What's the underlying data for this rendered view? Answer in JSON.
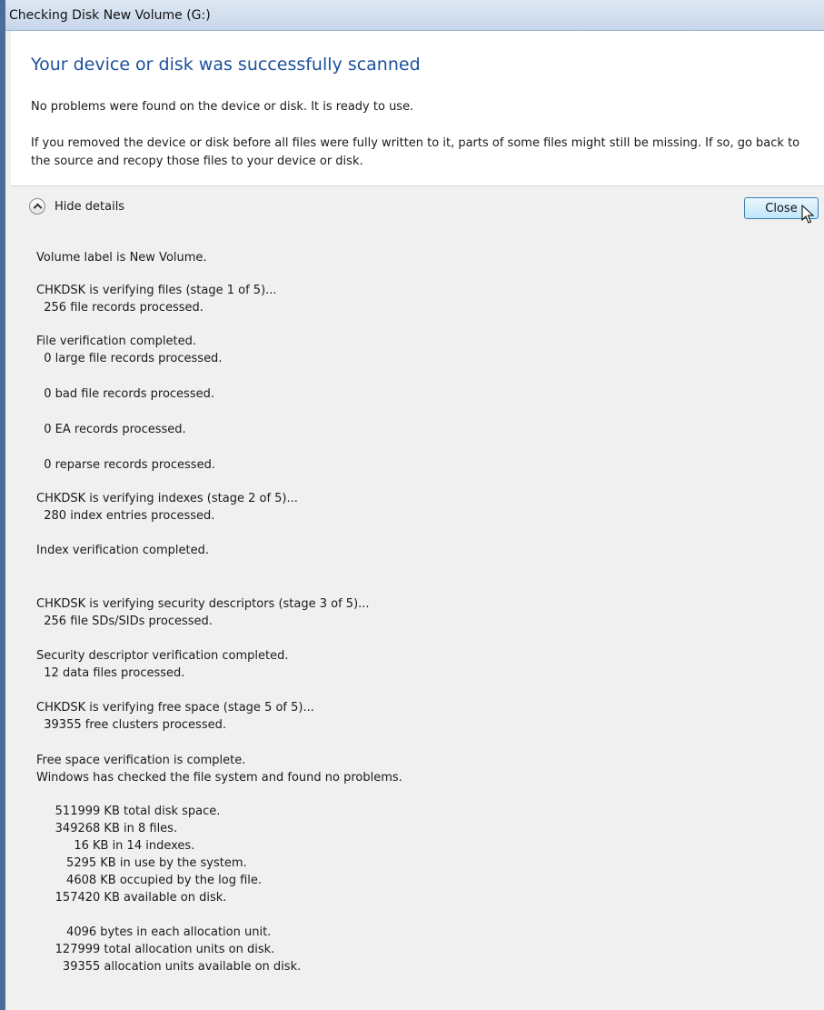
{
  "window": {
    "title": "Checking Disk New Volume (G:)"
  },
  "header": {
    "heading": "Your device or disk was successfully scanned",
    "message1": "No problems were found on the device or disk. It is ready to use.",
    "message2": "If you removed the device or disk before all files were fully written to it, parts of some files might still be missing. If so, go back to the source and recopy those files to your device or disk."
  },
  "toolbar": {
    "hide_details_label": "Hide details",
    "close_label": "Close",
    "toggle_icon": "chevron-up-icon"
  },
  "details": {
    "lines": [
      "Volume label is New Volume.",
      "CHKDSK is verifying files (stage 1 of 5)...",
      "  256 file records processed.",
      "File verification completed.",
      "  0 large file records processed.",
      "  0 bad file records processed.",
      "  0 EA records processed.",
      "  0 reparse records processed.",
      "CHKDSK is verifying indexes (stage 2 of 5)...",
      "  280 index entries processed.",
      "Index verification completed.",
      "CHKDSK is verifying security descriptors (stage 3 of 5)...",
      "  256 file SDs/SIDs processed.",
      "Security descriptor verification completed.",
      "  12 data files processed.",
      "CHKDSK is verifying free space (stage 5 of 5)...",
      "  39355 free clusters processed.",
      "Free space verification is complete.",
      "Windows has checked the file system and found no problems.",
      "     511999 KB total disk space.",
      "     349268 KB in 8 files.",
      "          16 KB in 14 indexes.",
      "        5295 KB in use by the system.",
      "        4608 KB occupied by the log file.",
      "     157420 KB available on disk.",
      "        4096 bytes in each allocation unit.",
      "     127999 total allocation units on disk.",
      "       39355 allocation units available on disk."
    ]
  }
}
